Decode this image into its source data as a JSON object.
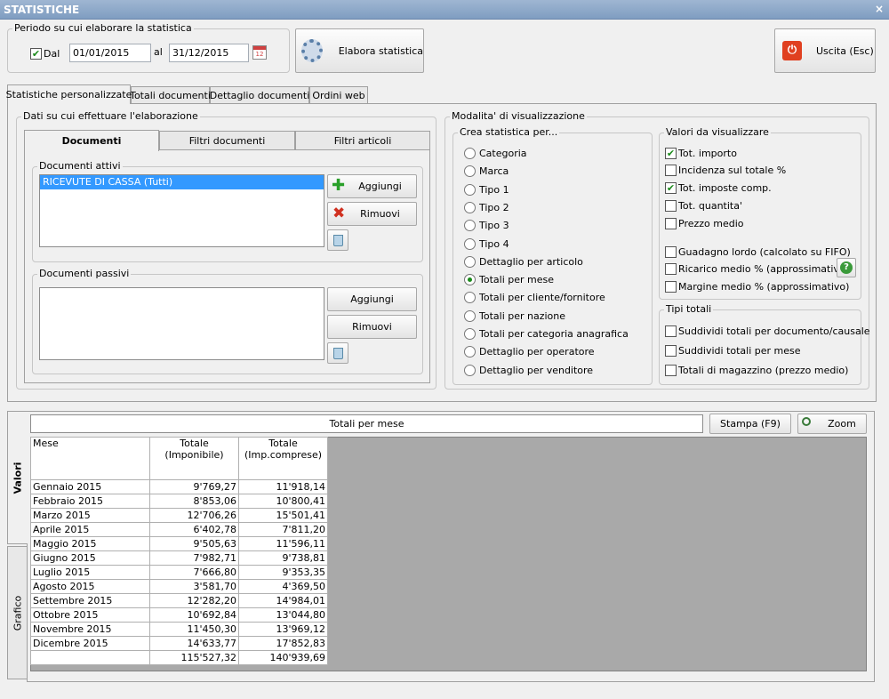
{
  "window": {
    "title": "STATISTICHE",
    "close": "×"
  },
  "period": {
    "group_label": "Periodo su cui elaborare la statistica",
    "dal_label": "Dal",
    "dal_checked": true,
    "from": "01/01/2015",
    "al_label": "al",
    "to": "31/12/2015"
  },
  "buttons": {
    "elabora": "Elabora statistica",
    "uscita": "Uscita (Esc)",
    "stampa": "Stampa (F9)",
    "zoom": "Zoom",
    "aggiungi": "Aggiungi",
    "rimuovi": "Rimuovi"
  },
  "main_tabs": [
    "Statistiche personalizzate",
    "Totali documenti",
    "Dettaglio documenti",
    "Ordini web"
  ],
  "data_group": {
    "label": "Dati su cui effettuare l'elaborazione",
    "tabs": [
      "Documenti",
      "Filtri documenti",
      "Filtri articoli"
    ],
    "attivi": {
      "label": "Documenti attivi",
      "items": [
        "RICEVUTE DI CASSA (Tutti)"
      ]
    },
    "passivi": {
      "label": "Documenti passivi"
    }
  },
  "modalita": {
    "label": "Modalita' di visualizzazione",
    "crea": {
      "label": "Crea statistica per...",
      "selected": "Totali per mese",
      "options": [
        "Categoria",
        "Marca",
        "Tipo 1",
        "Tipo 2",
        "Tipo 3",
        "Tipo 4",
        "Dettaglio per articolo",
        "Totali per mese",
        "Totali per cliente/fornitore",
        "Totali per nazione",
        "Totali per categoria anagrafica",
        "Dettaglio per operatore",
        "Dettaglio per venditore"
      ]
    },
    "valori": {
      "label": "Valori da visualizzare",
      "items": [
        {
          "label": "Tot. importo",
          "checked": true
        },
        {
          "label": "Incidenza sul totale %",
          "checked": false
        },
        {
          "label": "Tot. imposte comp.",
          "checked": true
        },
        {
          "label": "Tot. quantita'",
          "checked": false
        },
        {
          "label": "Prezzo medio",
          "checked": false
        },
        {
          "label": "Guadagno lordo (calcolato su FIFO)",
          "checked": false
        },
        {
          "label": "Ricarico medio % (approssimativo)",
          "checked": false
        },
        {
          "label": "Margine medio % (approssimativo)",
          "checked": false
        }
      ]
    },
    "tipi": {
      "label": "Tipi totali",
      "items": [
        {
          "label": "Suddividi totali per documento/causale",
          "checked": false
        },
        {
          "label": "Suddividi totali per mese",
          "checked": false
        },
        {
          "label": "Totali di magazzino (prezzo medio)",
          "checked": false
        }
      ]
    }
  },
  "results": {
    "title": "Totali per mese",
    "side_tabs": [
      "Valori",
      "Grafico"
    ],
    "columns": [
      "Mese",
      "Totale\n(Imponibile)",
      "Totale\n(Imp.comprese)"
    ],
    "rows": [
      [
        "Gennaio 2015",
        "9'769,27",
        "11'918,14"
      ],
      [
        "Febbraio 2015",
        "8'853,06",
        "10'800,41"
      ],
      [
        "Marzo 2015",
        "12'706,26",
        "15'501,41"
      ],
      [
        "Aprile 2015",
        "6'402,78",
        "7'811,20"
      ],
      [
        "Maggio 2015",
        "9'505,63",
        "11'596,11"
      ],
      [
        "Giugno 2015",
        "7'982,71",
        "9'738,81"
      ],
      [
        "Luglio 2015",
        "7'666,80",
        "9'353,35"
      ],
      [
        "Agosto 2015",
        "3'581,70",
        "4'369,50"
      ],
      [
        "Settembre 2015",
        "12'282,20",
        "14'984,01"
      ],
      [
        "Ottobre 2015",
        "10'692,84",
        "13'044,80"
      ],
      [
        "Novembre 2015",
        "11'450,30",
        "13'969,12"
      ],
      [
        "Dicembre 2015",
        "14'633,77",
        "17'852,83"
      ],
      [
        "",
        "115'527,32",
        "140'939,69"
      ]
    ]
  },
  "colors": {
    "accent": "#3399ff",
    "check": "#1a8a1a",
    "grid_bg": "#a9a9a9",
    "exit_red": "#e04020"
  },
  "icons": [
    "settings-gear-icon",
    "calendar-icon",
    "power-icon",
    "plus-icon",
    "x-remove-icon",
    "recycle-bin-icon",
    "help-icon",
    "magnifier-icon"
  ]
}
